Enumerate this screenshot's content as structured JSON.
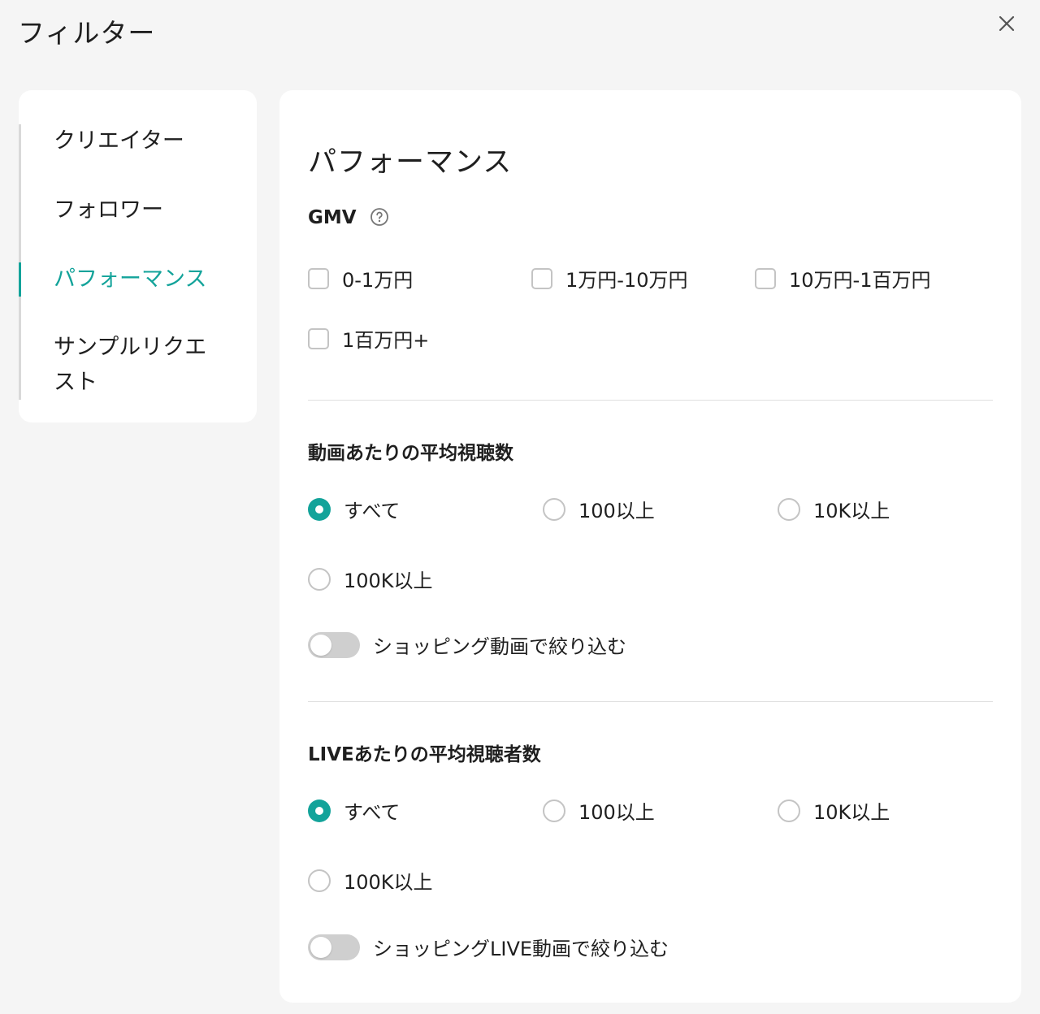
{
  "header": {
    "title": "フィルター",
    "close_icon": "close-icon"
  },
  "sidebar": {
    "items": [
      {
        "label": "クリエイター"
      },
      {
        "label": "フォロワー"
      },
      {
        "label": "パフォーマンス",
        "active": true
      },
      {
        "label": "サンプルリクエスト"
      }
    ]
  },
  "main": {
    "title": "パフォーマンス",
    "gmv": {
      "label": "GMV",
      "options": [
        "0-1万円",
        "1万円-10万円",
        "10万円-1百万円",
        "1百万円+"
      ]
    },
    "video_views": {
      "label": "動画あたりの平均視聴数",
      "options": [
        "すべて",
        "100以上",
        "10K以上",
        "100K以上"
      ],
      "selected": "すべて",
      "toggle_label": "ショッピング動画で絞り込む",
      "toggle_on": false
    },
    "live_views": {
      "label": "LIVEあたりの平均視聴者数",
      "options": [
        "すべて",
        "100以上",
        "10K以上",
        "100K以上"
      ],
      "selected": "すべて",
      "toggle_label": "ショッピングLIVE動画で絞り込む",
      "toggle_on": false
    }
  },
  "colors": {
    "accent": "#13a39a",
    "background": "#f5f5f5",
    "panel": "#ffffff"
  }
}
